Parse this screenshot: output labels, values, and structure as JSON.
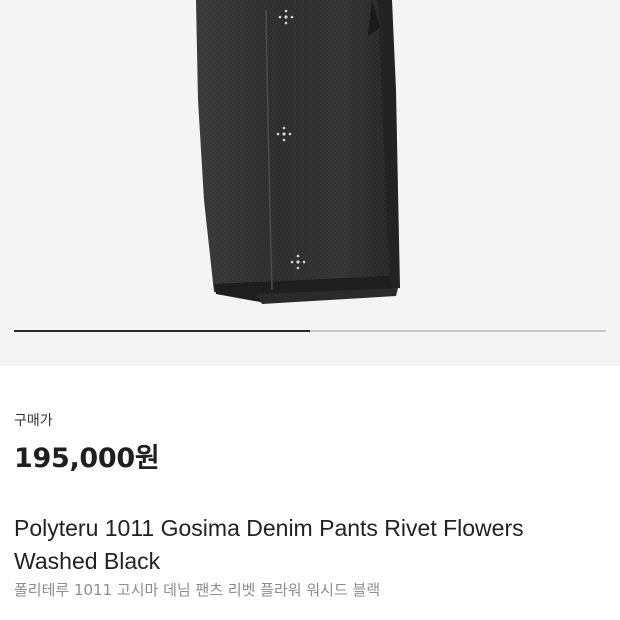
{
  "listing": {
    "image": {
      "subject": "black-denim-pants-photo",
      "background_color": "#f4f4f4",
      "denim_color": "#2e2e2e"
    },
    "gallery_progress": {
      "fraction": 0.5,
      "fill_color": "#2b2b2b",
      "track_color": "#c9c9c9"
    },
    "price_label": "구매가",
    "price": "195,000원",
    "title": "Polyteru 1011 Gosima Denim Pants Rivet Flowers Washed Black",
    "subtitle": "폴리테루 1011 고시마 데님 팬츠 리벳 플라워 워시드 블랙"
  }
}
